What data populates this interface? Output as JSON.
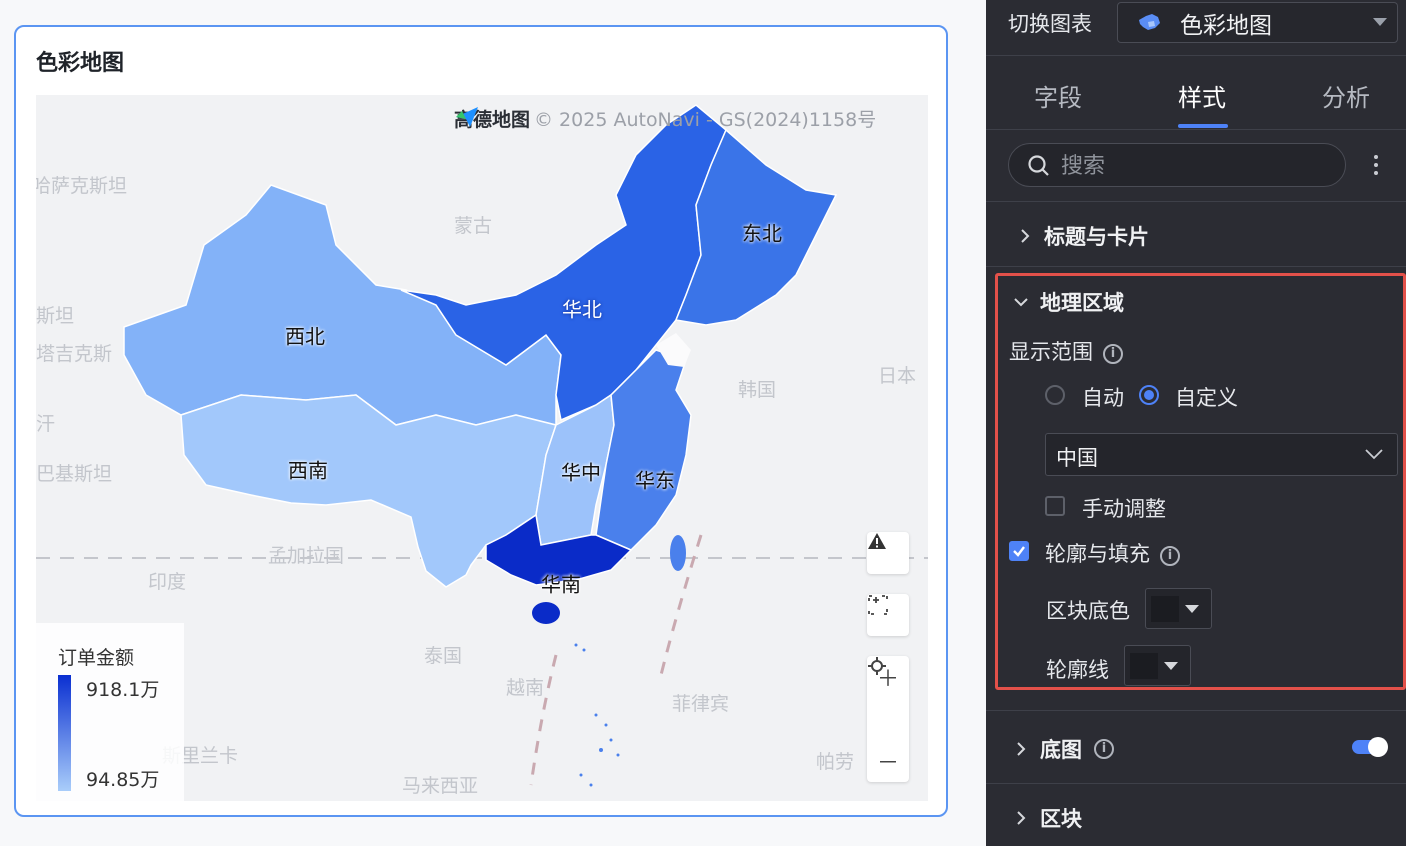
{
  "card": {
    "title": "色彩地图"
  },
  "map": {
    "attribution": {
      "brand": "高德地图",
      "text": "© 2025 AutoNavi - GS(2024)1158号"
    },
    "background_labels": [
      "哈萨克斯坦",
      "蒙古",
      "斯坦",
      "塔吉克斯",
      "汗",
      "巴基斯坦",
      "孟加拉国",
      "印度",
      "泰国",
      "越南",
      "菲律宾",
      "韩国",
      "日本",
      "斯里兰卡",
      "马来西亚",
      "帕劳"
    ],
    "regions": [
      {
        "name": "东北",
        "color": "#3a74e8"
      },
      {
        "name": "华北",
        "color": "#2a63e6"
      },
      {
        "name": "西北",
        "color": "#83b2f8"
      },
      {
        "name": "西南",
        "color": "#a2c8fb"
      },
      {
        "name": "华中",
        "color": "#9cc2fa"
      },
      {
        "name": "华东",
        "color": "#4a80ec"
      },
      {
        "name": "华南",
        "color": "#0a2bc8"
      }
    ],
    "legend": {
      "title": "订单金额",
      "max": "918.1万",
      "min": "94.85万"
    },
    "controls": [
      "warning-icon",
      "fit-screen-icon",
      "zoom-in-icon",
      "locate-icon",
      "zoom-out-icon"
    ]
  },
  "panel": {
    "switch_chart": {
      "label": "切换图表",
      "value": "色彩地图"
    },
    "tabs": [
      {
        "label": "字段",
        "active": false
      },
      {
        "label": "样式",
        "active": true
      },
      {
        "label": "分析",
        "active": false
      }
    ],
    "search": {
      "placeholder": "搜索"
    },
    "sections": {
      "title_card": "标题与卡片",
      "geo": {
        "title": "地理区域",
        "display_range": "显示范围",
        "auto": "自动",
        "custom": "自定义",
        "selected_range": "中国",
        "manual_adjust": "手动调整",
        "outline_fill": "轮廓与填充",
        "block_color": "区块底色",
        "outline": "轮廓线"
      },
      "basemap": "底图",
      "block": "区块"
    },
    "accent_color": "#4e82f7"
  }
}
